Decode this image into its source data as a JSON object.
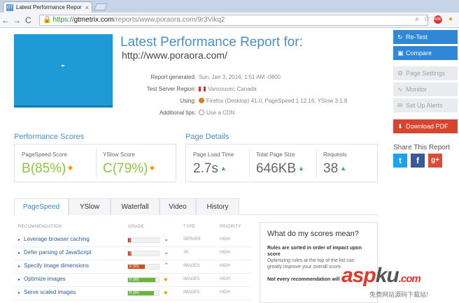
{
  "browser": {
    "tab_title": "Latest Performance Repor",
    "favicon": "GT",
    "url_scheme": "https://",
    "url_host": "gtmetrix.com",
    "url_path": "/reports/www.poraora.com/9r3Vikq2"
  },
  "report": {
    "title": "Latest Performance Report for:",
    "url": "http://www.poraora.com/",
    "meta": [
      {
        "key": "Report generated:",
        "value": "Sun, Jan 3, 2016, 1:51 AM -0800"
      },
      {
        "key": "Test Server Region:",
        "value": "Vancouver, Canada"
      },
      {
        "key": "Using:",
        "value": "Firefox (Desktop) 41.0, PageSpeed 1.12.16, YSlow 3.1.8"
      },
      {
        "key": "Additional tips:",
        "value": "Use a CDN"
      }
    ]
  },
  "sidebar": {
    "buttons": [
      {
        "label": "Re-Test",
        "icon": "refresh-icon"
      },
      {
        "label": "Compare",
        "icon": "compare-icon"
      },
      {
        "label": "Page Settings",
        "icon": "gear-icon"
      },
      {
        "label": "Monitor",
        "icon": "monitor-icon"
      },
      {
        "label": "Set Up Alerts",
        "icon": "alert-icon"
      },
      {
        "label": "Download PDF",
        "icon": "pdf-icon"
      }
    ],
    "share_title": "Share This Report",
    "social": [
      "t",
      "f",
      "g+"
    ]
  },
  "scores": {
    "title": "Performance Scores",
    "pagespeed": {
      "label": "PageSpeed Score",
      "grade": "B",
      "percent": "(85%)"
    },
    "yslow": {
      "label": "YSlow Score",
      "grade": "C",
      "percent": "(79%)"
    }
  },
  "details": {
    "title": "Page Details",
    "load_time": {
      "label": "Page Load Time",
      "value": "2.7s"
    },
    "page_size": {
      "label": "Total Page Size",
      "value": "646KB"
    },
    "requests": {
      "label": "Requests",
      "value": "38"
    }
  },
  "tabs": [
    "PageSpeed",
    "YSlow",
    "Waterfall",
    "Video",
    "History"
  ],
  "table": {
    "headers": [
      "RECOMMENDATION",
      "GRADE",
      "TYPE",
      "PRIORITY"
    ],
    "rows": [
      {
        "name": "Leverage browser caching",
        "grade": "(2)",
        "score": 0.1,
        "color": "#d33a2c",
        "trend": "down",
        "type": "SERVER",
        "priority": "HIGH"
      },
      {
        "name": "Defer parsing of JavaScript",
        "grade": "(8)",
        "score": 0.12,
        "color": "#d33a2c",
        "trend": "down",
        "type": "JS",
        "priority": "HIGH"
      },
      {
        "name": "Specify image dimensions",
        "grade": "E (55)",
        "score": 0.55,
        "color": "#c8531d",
        "trend": "up",
        "type": "IMAGES",
        "priority": "HIGH"
      },
      {
        "name": "Optimize images",
        "grade": "B (88)",
        "score": 0.88,
        "color": "#6ab43e",
        "trend": "diamond",
        "type": "IMAGES",
        "priority": "HIGH"
      },
      {
        "name": "Serve scaled images",
        "grade": "B (84)",
        "score": 0.84,
        "color": "#6ab43e",
        "trend": "diamond",
        "type": "IMAGES",
        "priority": "HIGH"
      }
    ]
  },
  "explain": {
    "title": "What do my scores mean?",
    "bold1": "Rules are sorted in order of impact upon score",
    "text1": "Optimizing rules at the top of the list can greatly improve your overall score.",
    "bold2": "Not every recommendation will"
  },
  "watermark": {
    "a": "asp",
    "k": "ku",
    "dom": ".com",
    "sub": "免费网站源码下载站!"
  },
  "colors": {
    "accent": "#4a8fc9",
    "button_blue": "#2f87d6",
    "grade_green": "#8cc63f",
    "pdf_red": "#d9442e"
  }
}
